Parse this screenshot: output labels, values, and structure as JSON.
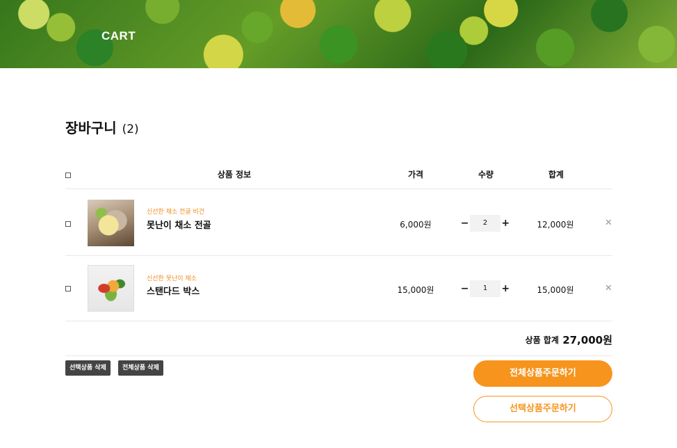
{
  "hero": {
    "title": "CART"
  },
  "cart": {
    "title": "장바구니",
    "count": "(2)"
  },
  "table": {
    "headers": {
      "product": "상품 정보",
      "price": "가격",
      "quantity": "수량",
      "subtotal": "합계"
    },
    "rows": [
      {
        "category": "신선한 채소 전골 비건",
        "name": "못난이 채소 전골",
        "price": "6,000원",
        "qty": "2",
        "subtotal": "12,000원"
      },
      {
        "category": "신선한 못난이 채소",
        "name": "스탠다드 박스",
        "price": "15,000원",
        "qty": "1",
        "subtotal": "15,000원"
      }
    ]
  },
  "controls": {
    "minus": "−",
    "plus": "+",
    "remove": "✕"
  },
  "total": {
    "label": "상품 합계",
    "value": "27,000원"
  },
  "actions": {
    "delete_selected": "선택상품 삭제",
    "delete_all": "전체상품 삭제",
    "order_all": "전체상품주문하기",
    "order_selected": "선택상품주문하기"
  },
  "colors": {
    "accent": "#f7941d",
    "dark_button": "#444444"
  }
}
